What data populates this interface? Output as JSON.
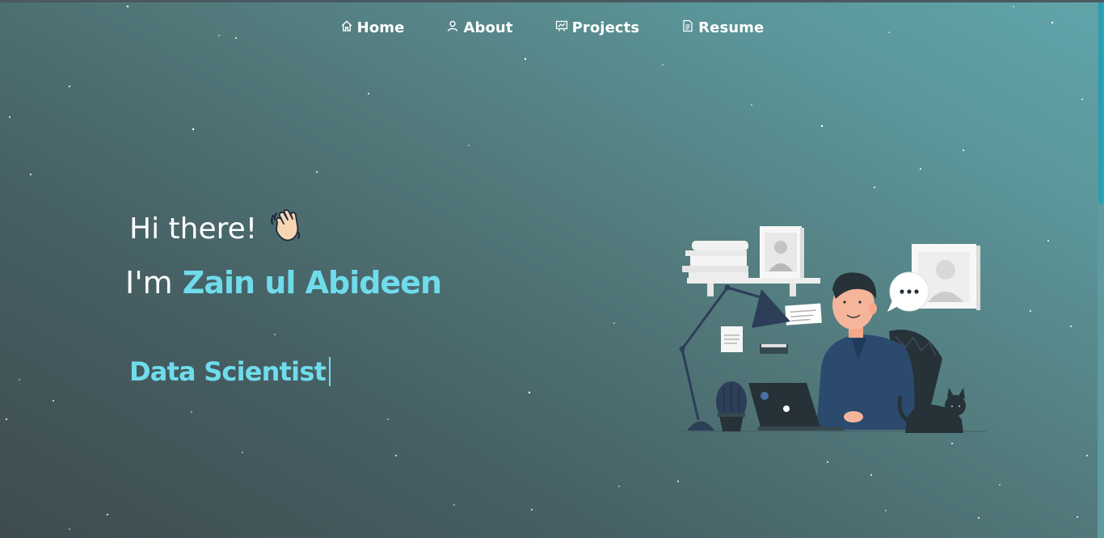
{
  "nav": {
    "items": [
      {
        "label": "Home",
        "icon": "home-icon"
      },
      {
        "label": "About",
        "icon": "user-icon"
      },
      {
        "label": "Projects",
        "icon": "presentation-icon"
      },
      {
        "label": "Resume",
        "icon": "document-icon"
      }
    ]
  },
  "hero": {
    "greeting": "Hi there!",
    "intro_prefix": "I'm",
    "name": "Zain ul Abideen",
    "role": "Data Scientist"
  },
  "colors": {
    "accent": "#6fdcec",
    "text": "#ffffff",
    "bg_dark": "#3e4c4f",
    "bg_light": "#60a5aa"
  }
}
